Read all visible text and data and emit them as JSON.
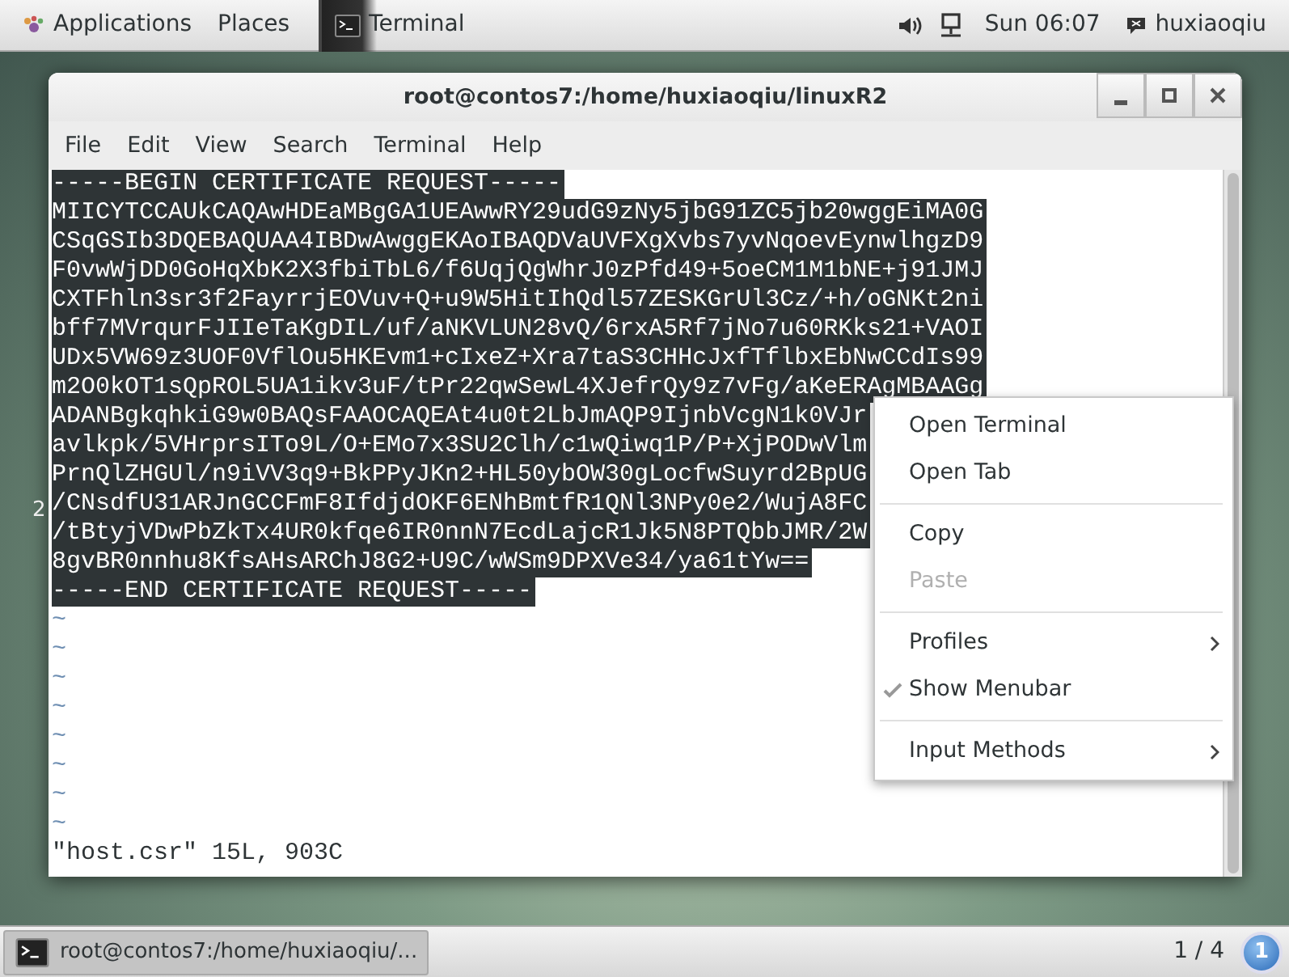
{
  "top_bar": {
    "menus": [
      {
        "label": "Applications"
      },
      {
        "label": "Places"
      }
    ],
    "active_app": "Terminal",
    "clock": "Sun 06:07",
    "user": "huxiaoqiu"
  },
  "desktop_mark": "2",
  "window": {
    "title": "root@contos7:/home/huxiaoqiu/linuxR2",
    "menu": [
      {
        "label": "File"
      },
      {
        "label": "Edit"
      },
      {
        "label": "View"
      },
      {
        "label": "Search"
      },
      {
        "label": "Terminal"
      },
      {
        "label": "Help"
      }
    ],
    "lines": [
      {
        "text": "-----BEGIN CERTIFICATE REQUEST-----",
        "selected": true
      },
      {
        "text": "MIICYTCCAUkCAQAwHDEaMBgGA1UEAwwRY29udG9zNy5jbG91ZC5jb20wggEiMA0G",
        "selected": true
      },
      {
        "text": "CSqGSIb3DQEBAQUAA4IBDwAwggEKAoIBAQDVaUVFXgXvbs7yvNqoevEynwlhgzD9",
        "selected": true
      },
      {
        "text": "F0vwWjDD0GoHqXbK2X3fbiTbL6/f6UqjQgWhrJ0zPfd49+5oeCM1M1bNE+j91JMJ",
        "selected": true
      },
      {
        "text": "CXTFhln3sr3f2FayrrjEOVuv+Q+u9W5HitIhQdl57ZESKGrUl3Cz/+h/oGNKt2ni",
        "selected": true
      },
      {
        "text": "bff7MVrqurFJIIeTaKgDIL/uf/aNKVLUN28vQ/6rxA5Rf7jNo7u60RKks21+VAOI",
        "selected": true
      },
      {
        "text": "UDx5VW69z3UOF0VflOu5HKEvm1+cIxeZ+Xra7taS3CHHcJxfTflbxEbNwCCdIs99",
        "selected": true
      },
      {
        "text": "m2O0kOT1sQpROL5UA1ikv3uF/tPr22qwSewL4XJefrQy9z7vFg/aKeERAgMBAAGg",
        "selected": true
      },
      {
        "text": "ADANBgkqhkiG9w0BAQsFAAOCAQEAt4u0t2LbJmAQP9IjnbVcgN1k0VJr",
        "selected": true
      },
      {
        "text": "avlkpk/5VHrprsITo9L/O+EMo7x3SU2Clh/c1wQiwq1P/P+XjPODwVlm",
        "selected": true
      },
      {
        "text": "PrnQlZHGUl/n9iVV3q9+BkPPyJKn2+HL50ybOW30gLocfwSuyrd2BpUG",
        "selected": true
      },
      {
        "text": "/CNsdfU31ARJnGCCFmF8IfdjdOKF6ENhBmtfR1QNl3NPy0e2/WujA8FC",
        "selected": true
      },
      {
        "text": "/tBtyjVDwPbZkTx4UR0kfqe6IR0nnN7EcdLajcR1Jk5N8PTQbbJMR/2W",
        "selected": true
      },
      {
        "text": "8gvBR0nnhu8KfsAHsARChJ8G2+U9C/wWSm9DPXVe34/ya61tYw==",
        "selected": true
      },
      {
        "text": "-----END CERTIFICATE REQUEST-----",
        "selected": true
      }
    ],
    "empty_lines": [
      "~",
      "~",
      "~",
      "~",
      "~",
      "~",
      "~",
      "~"
    ],
    "status": "\"host.csr\" 15L, 903C"
  },
  "context_menu": {
    "items": [
      {
        "kind": "item",
        "label": "Open Terminal",
        "disabled": false,
        "checked": false,
        "submenu": false
      },
      {
        "kind": "item",
        "label": "Open Tab",
        "disabled": false,
        "checked": false,
        "submenu": false
      },
      {
        "kind": "separator"
      },
      {
        "kind": "item",
        "label": "Copy",
        "disabled": false,
        "checked": false,
        "submenu": false
      },
      {
        "kind": "item",
        "label": "Paste",
        "disabled": true,
        "checked": false,
        "submenu": false
      },
      {
        "kind": "separator"
      },
      {
        "kind": "item",
        "label": "Profiles",
        "disabled": false,
        "checked": false,
        "submenu": true
      },
      {
        "kind": "item",
        "label": "Show Menubar",
        "disabled": false,
        "checked": true,
        "submenu": false
      },
      {
        "kind": "separator"
      },
      {
        "kind": "item",
        "label": "Input Methods",
        "disabled": false,
        "checked": false,
        "submenu": true
      }
    ]
  },
  "taskbar": {
    "tasks": [
      {
        "label": "root@contos7:/home/huxiaoqiu/...",
        "selected": true
      }
    ],
    "workspace": "1 / 4",
    "notification_count": "1"
  }
}
